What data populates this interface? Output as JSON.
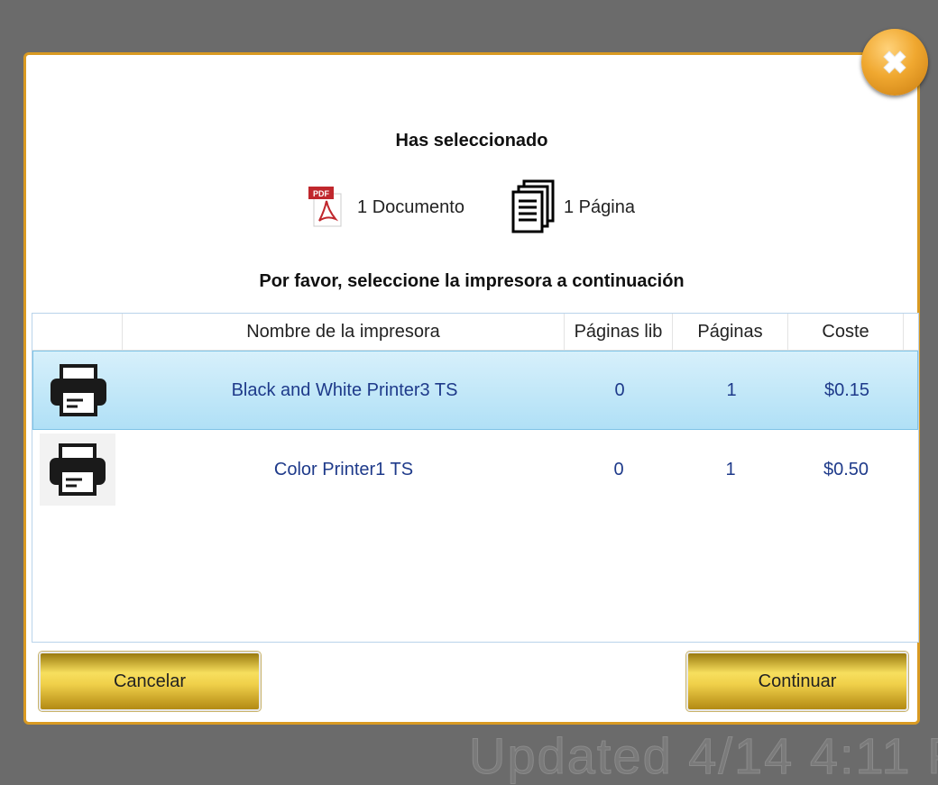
{
  "background": {
    "watermark_text": "Updated 4/14 4:11 P"
  },
  "dialog": {
    "title": "Has seleccionado",
    "documents_label": "1 Documento",
    "pages_label": "1 Página",
    "instruction": "Por favor, seleccione la impresora a continuación",
    "pdf_badge": "PDF",
    "accent_color": "#d99a22"
  },
  "table": {
    "headers": {
      "name": "Nombre de la impresora",
      "free_pages": "Páginas lib",
      "pages": "Páginas",
      "cost": "Coste"
    },
    "rows": [
      {
        "name": "Black and White Printer3 TS",
        "free_pages": "0",
        "pages": "1",
        "cost": "$0.15",
        "selected": true
      },
      {
        "name": "Color Printer1 TS",
        "free_pages": "0",
        "pages": "1",
        "cost": "$0.50",
        "selected": false
      }
    ]
  },
  "buttons": {
    "cancel": "Cancelar",
    "continue": "Continuar"
  }
}
